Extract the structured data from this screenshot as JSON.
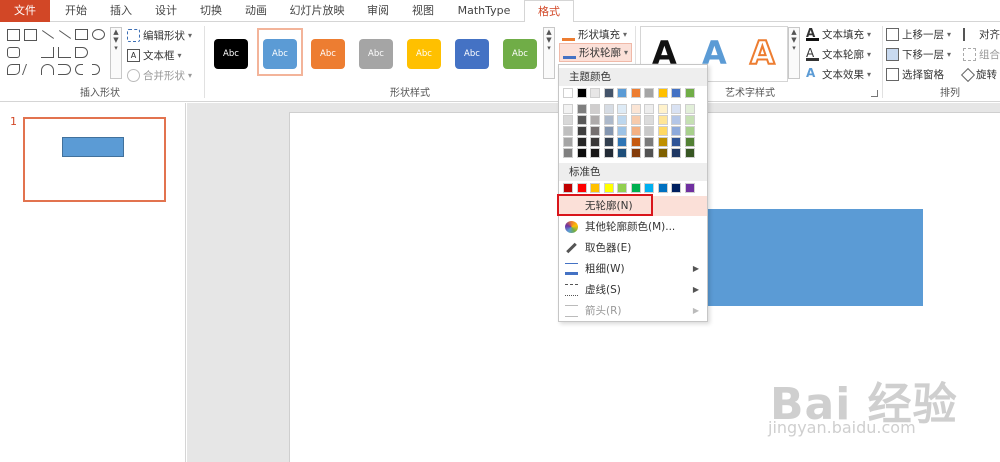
{
  "tabs": [
    {
      "label": "文件"
    },
    {
      "label": "开始"
    },
    {
      "label": "插入"
    },
    {
      "label": "设计"
    },
    {
      "label": "切换"
    },
    {
      "label": "动画"
    },
    {
      "label": "幻灯片放映"
    },
    {
      "label": "审阅"
    },
    {
      "label": "视图"
    },
    {
      "label": "MathType"
    },
    {
      "label": "格式"
    }
  ],
  "ribbon": {
    "insert_shapes": {
      "edit_shape": "编辑形状",
      "text_box": "文本框",
      "merge_shapes": "合并形状",
      "label": "插入形状"
    },
    "shape_styles": {
      "label": "形状样式",
      "style_text": "Abc",
      "colors": [
        "#000000",
        "#5b9bd5",
        "#ed7d31",
        "#a5a5a5",
        "#ffc000",
        "#4472c4",
        "#70ad47"
      ]
    },
    "shape_fill": "形状填充",
    "shape_outline": "形状轮廓",
    "wordart": {
      "label": "艺术字样式",
      "glyph": "A",
      "text_fill": "文本填充",
      "text_outline": "文本轮廓",
      "text_effects": "文本效果"
    },
    "arrange": {
      "label": "排列",
      "bring_forward": "上移一层",
      "send_backward": "下移一层",
      "selection_pane": "选择窗格",
      "align": "对齐",
      "group": "组合",
      "rotate": "旋转"
    }
  },
  "slides_panel": {
    "slide_number": "1"
  },
  "outline_menu": {
    "theme_colors_label": "主题颜色",
    "standard_colors_label": "标准色",
    "theme_row": [
      "#ffffff",
      "#000000",
      "#e7e6e6",
      "#44546a",
      "#5b9bd5",
      "#ed7d31",
      "#a5a5a5",
      "#ffc000",
      "#4472c4",
      "#70ad47"
    ],
    "theme_shades": [
      [
        "#f2f2f2",
        "#7f7f7f",
        "#d0cece",
        "#d6dce4",
        "#deebf6",
        "#fbe5d5",
        "#ededed",
        "#fff2cc",
        "#d9e2f3",
        "#e2efd9"
      ],
      [
        "#d8d8d8",
        "#595959",
        "#aeabab",
        "#adb9ca",
        "#bdd7ee",
        "#f7cbac",
        "#dbdbdb",
        "#fee599",
        "#b4c6e7",
        "#c5e0b3"
      ],
      [
        "#bfbfbf",
        "#3f3f3f",
        "#757070",
        "#8496b0",
        "#9dc3e6",
        "#f4b183",
        "#c9c9c9",
        "#ffd965",
        "#8eaadb",
        "#a8d08d"
      ],
      [
        "#a5a5a5",
        "#262626",
        "#3a3838",
        "#323f4f",
        "#2e75b5",
        "#c55a11",
        "#7b7b7b",
        "#bf9000",
        "#2f5496",
        "#538135"
      ],
      [
        "#7f7f7f",
        "#0c0c0c",
        "#171616",
        "#222a35",
        "#1e4e79",
        "#843c0b",
        "#525252",
        "#7f6000",
        "#1f3864",
        "#375623"
      ]
    ],
    "standard_row": [
      "#c00000",
      "#ff0000",
      "#ffc000",
      "#ffff00",
      "#92d050",
      "#00b050",
      "#00b0f0",
      "#0070c0",
      "#002060",
      "#7030a0"
    ],
    "items": [
      {
        "label": "无轮廓(N)"
      },
      {
        "label": "其他轮廓颜色(M)..."
      },
      {
        "label": "取色器(E)"
      },
      {
        "label": "粗细(W)"
      },
      {
        "label": "虚线(S)"
      },
      {
        "label": "箭头(R)"
      }
    ]
  },
  "watermark": {
    "brand": "Bai 经验",
    "url": "jingyan.baidu.com"
  }
}
